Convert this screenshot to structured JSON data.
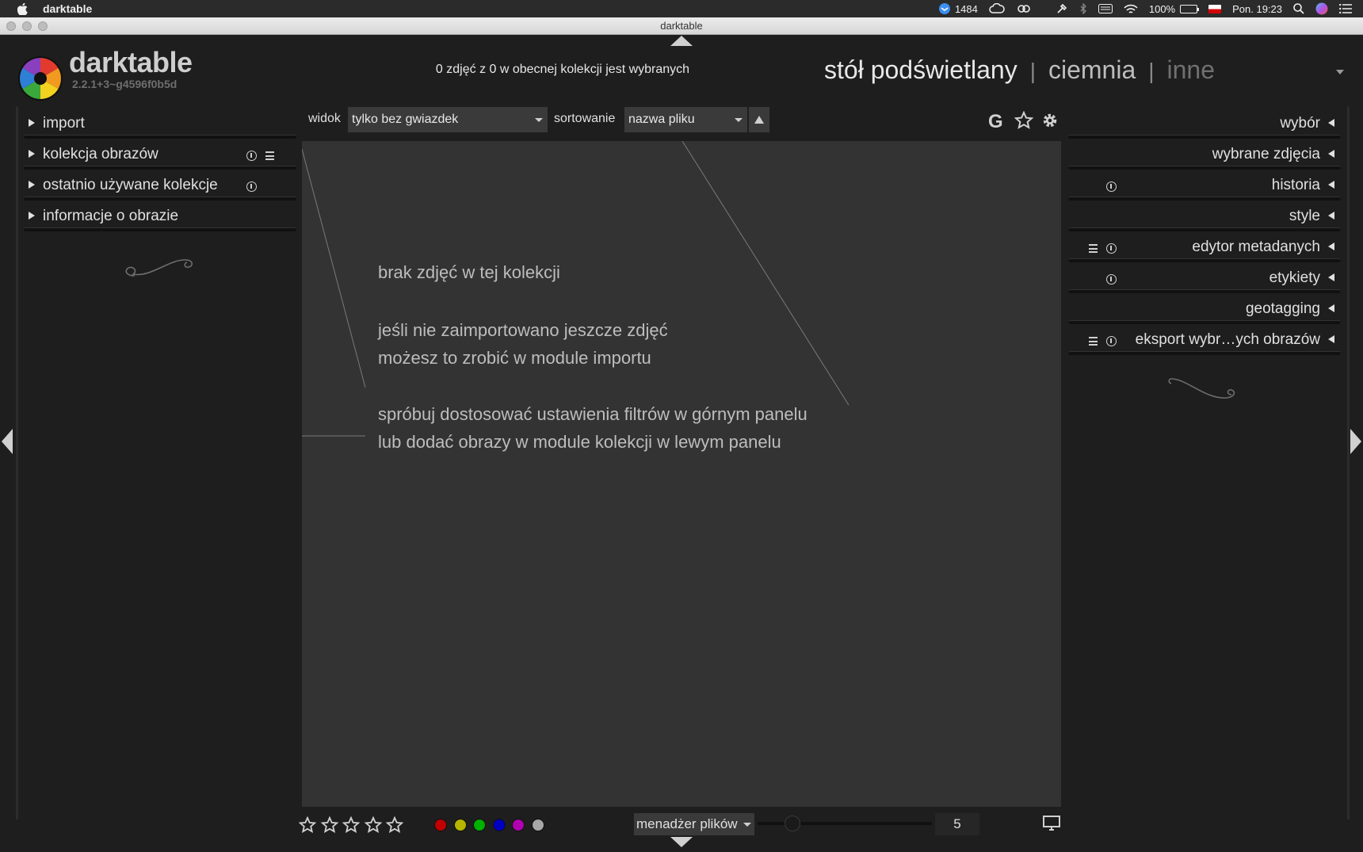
{
  "menubar": {
    "app_name": "darktable",
    "badge_count": "1484",
    "battery": "100%",
    "clock": "Pon. 19:23"
  },
  "window": {
    "title": "darktable"
  },
  "header": {
    "app_name": "darktable",
    "version": "2.2.1+3~g4596f0b5d",
    "selection_status": "0 zdjęć z 0 w obecnej kolekcji jest wybranych",
    "views": [
      "stół podświetlany",
      "ciemnia",
      "inne"
    ],
    "active_view": "stół podświetlany"
  },
  "left_panel": {
    "modules": [
      {
        "label": "import"
      },
      {
        "label": "kolekcja obrazów"
      },
      {
        "label": "ostatnio używane kolekcje"
      },
      {
        "label": "informacje o obrazie"
      }
    ]
  },
  "right_panel": {
    "modules": [
      {
        "label": "wybór"
      },
      {
        "label": "wybrane zdjęcia"
      },
      {
        "label": "historia"
      },
      {
        "label": "style"
      },
      {
        "label": "edytor metadanych"
      },
      {
        "label": "etykiety"
      },
      {
        "label": "geotagging"
      },
      {
        "label": "eksport wybr…ych obrazów"
      }
    ]
  },
  "toolbar": {
    "view_label": "widok",
    "view_value": "tylko bez gwiazdek",
    "sort_label": "sortowanie",
    "sort_value": "nazwa pliku",
    "grouping_icon": "G"
  },
  "center": {
    "line1": "brak zdjęć w tej kolekcji",
    "line2": "jeśli nie zaimportowano jeszcze zdjęć",
    "line3": "możesz to zrobić w module importu",
    "line4": "spróbuj dostosować ustawienia filtrów w górnym panelu",
    "line5": "lub dodać obrazy w module kolekcji w lewym panelu"
  },
  "bottom": {
    "star_count": 5,
    "color_labels": [
      "#c00000",
      "#b5b500",
      "#00b000",
      "#0000c0",
      "#b000b0",
      "#a8a8a8"
    ],
    "layout_value": "menadżer plików",
    "zoom_value": "5"
  }
}
